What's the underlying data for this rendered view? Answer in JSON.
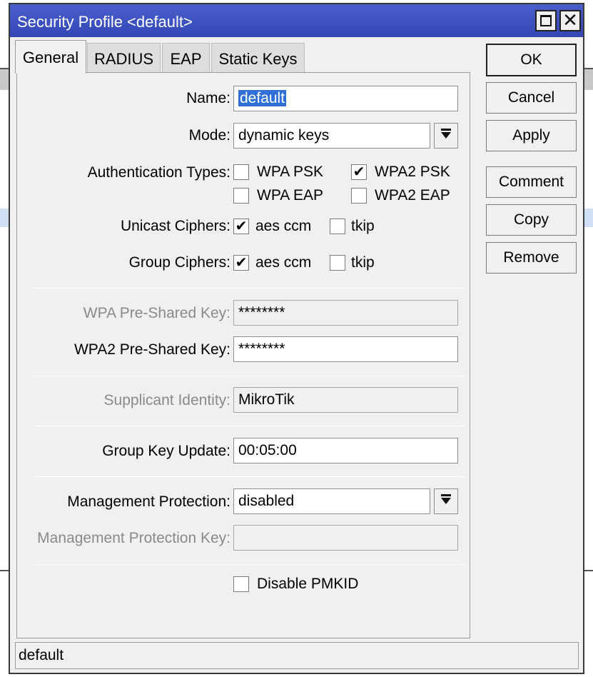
{
  "window": {
    "title": "Security Profile <default>",
    "status_text": "default"
  },
  "tabs": [
    {
      "label": "General",
      "active": true
    },
    {
      "label": "RADIUS",
      "active": false
    },
    {
      "label": "EAP",
      "active": false
    },
    {
      "label": "Static Keys",
      "active": false
    }
  ],
  "form": {
    "name": {
      "label": "Name:",
      "value": "default"
    },
    "mode": {
      "label": "Mode:",
      "value": "dynamic keys"
    },
    "auth_types": {
      "label": "Authentication Types:",
      "options": [
        {
          "label": "WPA PSK",
          "checked": false
        },
        {
          "label": "WPA2 PSK",
          "checked": true
        },
        {
          "label": "WPA EAP",
          "checked": false
        },
        {
          "label": "WPA2 EAP",
          "checked": false
        }
      ]
    },
    "unicast_ciphers": {
      "label": "Unicast Ciphers:",
      "options": [
        {
          "label": "aes ccm",
          "checked": true
        },
        {
          "label": "tkip",
          "checked": false
        }
      ]
    },
    "group_ciphers": {
      "label": "Group Ciphers:",
      "options": [
        {
          "label": "aes ccm",
          "checked": true
        },
        {
          "label": "tkip",
          "checked": false
        }
      ]
    },
    "wpa_psk": {
      "label": "WPA Pre-Shared Key:",
      "value": "********"
    },
    "wpa2_psk": {
      "label": "WPA2 Pre-Shared Key:",
      "value": "********"
    },
    "supplicant_identity": {
      "label": "Supplicant Identity:",
      "value": "MikroTik"
    },
    "group_key_update": {
      "label": "Group Key Update:",
      "value": "00:05:00"
    },
    "management_protection": {
      "label": "Management Protection:",
      "value": "disabled"
    },
    "management_protection_key": {
      "label": "Management Protection Key:",
      "value": ""
    },
    "disable_pmkid": {
      "label": "Disable PMKID",
      "checked": false
    }
  },
  "buttons": {
    "ok": "OK",
    "cancel": "Cancel",
    "apply": "Apply",
    "comment": "Comment",
    "copy": "Copy",
    "remove": "Remove"
  },
  "icons": {
    "check": "✔",
    "close": "✕"
  },
  "colors": {
    "titlebar": "#3c50c0",
    "selection": "#2f6fd6"
  }
}
